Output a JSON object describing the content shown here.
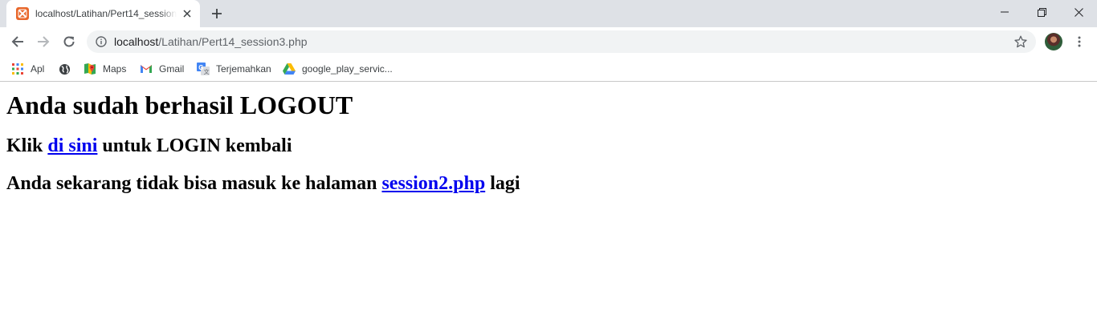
{
  "tab": {
    "title": "localhost/Latihan/Pert14_session3.php",
    "favicon": "xampp-icon"
  },
  "address_bar": {
    "host": "localhost",
    "path": "/Latihan/Pert14_session3.php"
  },
  "bookmarks": [
    {
      "label": "Apl",
      "icon": "apps-grid-icon"
    },
    {
      "label": "",
      "icon": "globe-icon"
    },
    {
      "label": "Maps",
      "icon": "maps-icon"
    },
    {
      "label": "Gmail",
      "icon": "gmail-icon"
    },
    {
      "label": "Terjemahkan",
      "icon": "translate-icon"
    },
    {
      "label": "google_play_servic...",
      "icon": "drive-icon"
    }
  ],
  "page": {
    "heading": "Anda sudah berhasil LOGOUT",
    "line1": {
      "prefix": "Klik ",
      "link": "di sini",
      "suffix": " untuk LOGIN kembali"
    },
    "line2": {
      "prefix": "Anda sekarang tidak bisa masuk ke halaman ",
      "link": "session2.php",
      "suffix": " lagi"
    }
  },
  "colors": {
    "tabstrip": "#dee1e6",
    "omnibox": "#f1f3f4",
    "link": "#0000ee",
    "favicon": "#e8672b"
  }
}
